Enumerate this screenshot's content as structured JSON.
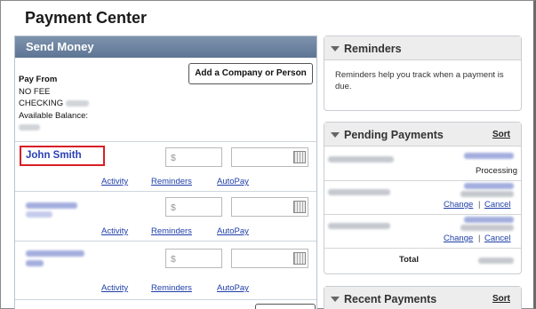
{
  "page": {
    "title": "Payment Center"
  },
  "send_money": {
    "header": "Send Money",
    "pay_from_label": "Pay From",
    "fee": "NO FEE",
    "account": "CHECKING",
    "balance_label": "Available Balance:",
    "add_button": "Add a Company or Person",
    "payees": [
      {
        "name": "John Smith",
        "amount_placeholder": "$",
        "links": [
          "Activity",
          "Reminders",
          "AutoPay"
        ]
      },
      {
        "name": "",
        "amount_placeholder": "$",
        "links": [
          "Activity",
          "Reminders",
          "AutoPay"
        ]
      },
      {
        "name": "",
        "amount_placeholder": "$",
        "links": [
          "Activity",
          "Reminders",
          "AutoPay"
        ]
      }
    ]
  },
  "reminders": {
    "header": "Reminders",
    "text": "Reminders help you track when a payment is due."
  },
  "pending": {
    "header": "Pending Payments",
    "sort": "Sort",
    "rows": [
      {
        "status": "Processing"
      },
      {
        "change": "Change",
        "sep": "|",
        "cancel": "Cancel"
      },
      {
        "change": "Change",
        "sep": "|",
        "cancel": "Cancel"
      }
    ],
    "total_label": "Total"
  },
  "recent": {
    "header": "Recent Payments",
    "sort": "Sort"
  },
  "colors": {
    "header_blue": "#5d7594",
    "link_blue": "#1f3ea8",
    "highlight_red": "#d81f26"
  }
}
